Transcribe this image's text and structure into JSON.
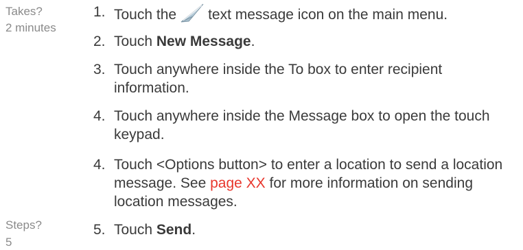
{
  "sidebar": {
    "takes_label": "Takes?",
    "takes_value": "2 minutes",
    "steps_label": "Steps?",
    "steps_value": "5"
  },
  "steps": [
    {
      "number": "1.",
      "before_icon": "Touch the",
      "icon": "message-icon",
      "after_icon": "text message icon on the main menu."
    },
    {
      "number": "2.",
      "prefix": "Touch ",
      "bold": "New Message",
      "suffix": "."
    },
    {
      "number": "3.",
      "text": "Touch anywhere inside the To box to enter recipient information."
    },
    {
      "number": "4.",
      "text": "Touch anywhere inside the Message box to open the touch keypad."
    },
    {
      "number": "4.",
      "prefix": "Touch <Options button> to enter a location to send a location message. See ",
      "link": "page XX",
      "suffix": " for more information on sending location messages."
    },
    {
      "number": "5.",
      "prefix": "Touch ",
      "bold": "Send",
      "suffix": "."
    }
  ],
  "colors": {
    "link": "#e8362c",
    "sidebar_text": "#8a8a8a",
    "body_text": "#3a3a3a"
  }
}
